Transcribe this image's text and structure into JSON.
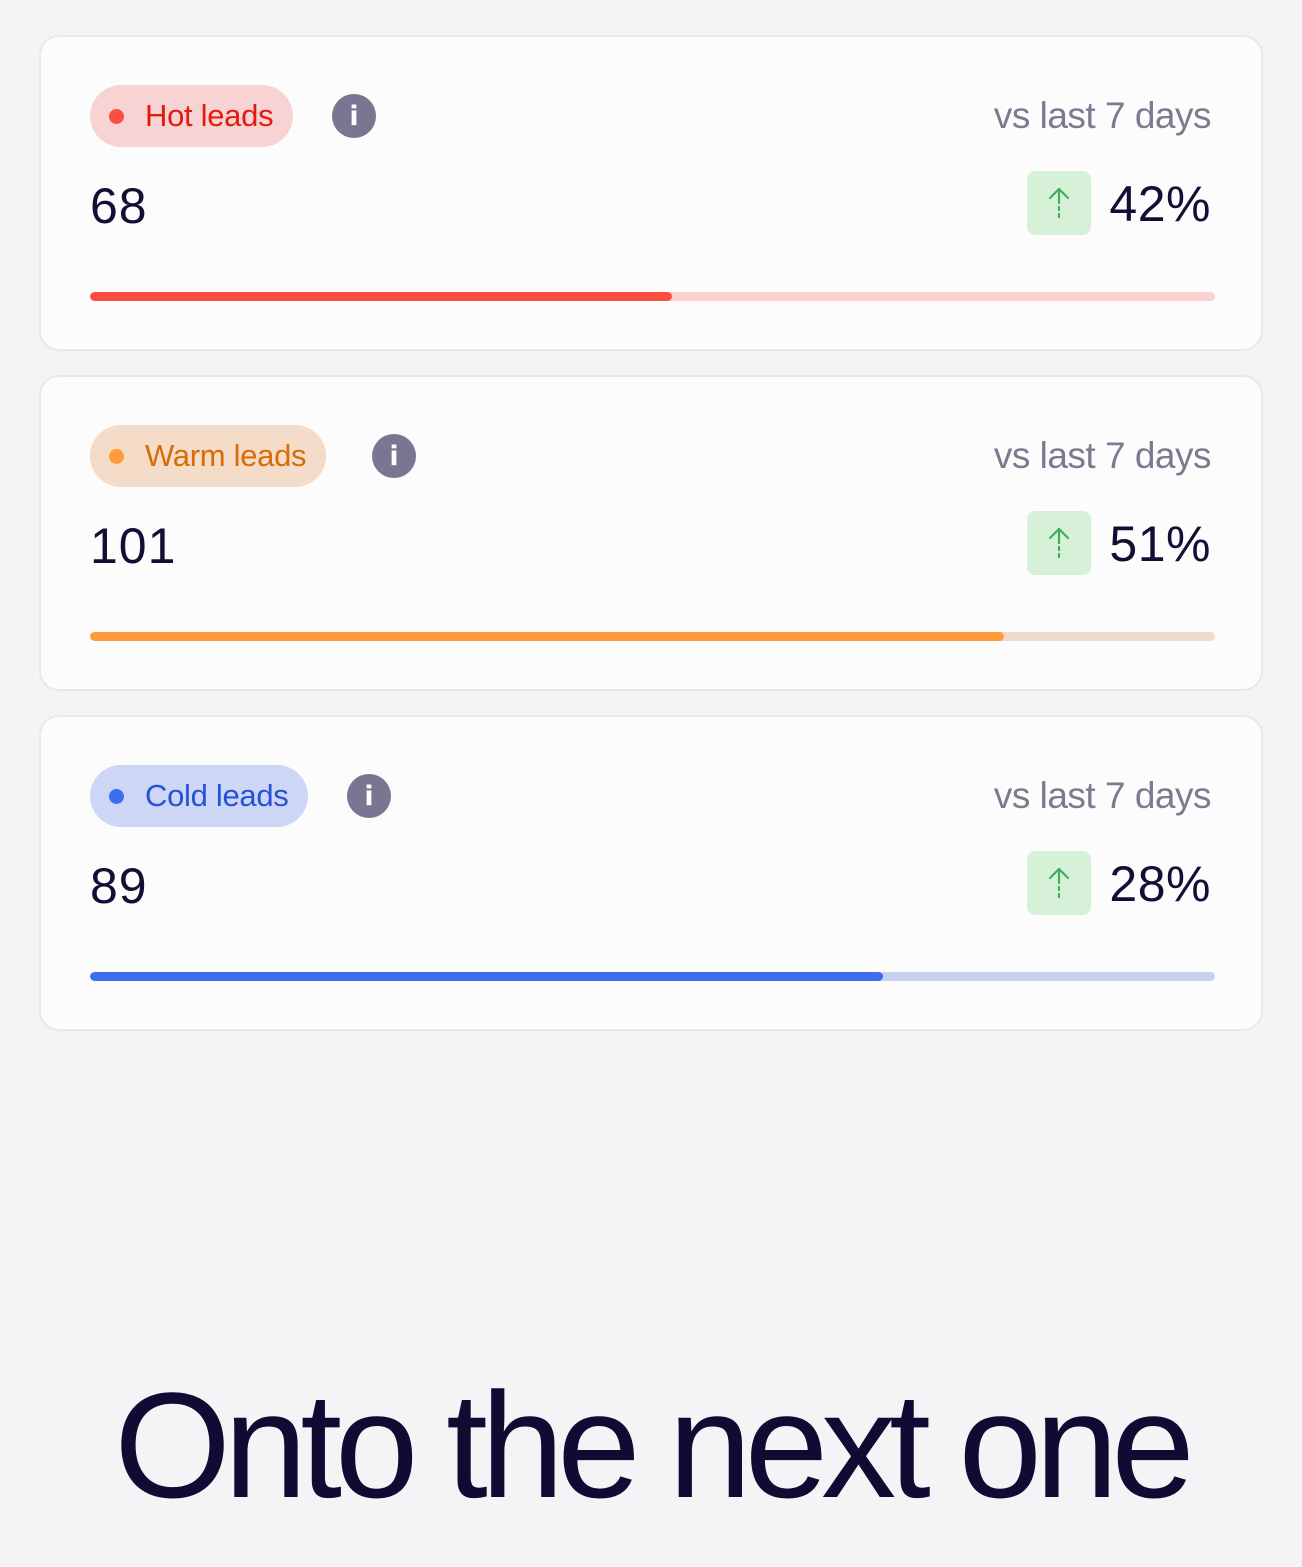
{
  "cards": [
    {
      "label": "Hot leads",
      "count": "68",
      "period": "vs last 7 days",
      "change": "42%",
      "trend": "up-arrow-icon",
      "progress": 0.517,
      "colors": {
        "accent": "#fc4d41",
        "pill_bg": "#f8d3d3",
        "label": "#e31b0f",
        "track": "#fad1d1"
      }
    },
    {
      "label": "Warm leads",
      "count": "101",
      "period": "vs last 7 days",
      "change": "51%",
      "trend": "up-arrow-icon",
      "progress": 0.812,
      "colors": {
        "accent": "#ff9b3b",
        "pill_bg": "#f4dcc8",
        "label": "#d76d07",
        "track": "#efdbc9"
      }
    },
    {
      "label": "Cold leads",
      "count": "89",
      "period": "vs last 7 days",
      "change": "28%",
      "trend": "up-arrow-icon",
      "progress": 0.705,
      "colors": {
        "accent": "#3d6ef1",
        "pill_bg": "#cdd6f4",
        "label": "#2453d9",
        "track": "#c7d0ef"
      }
    }
  ],
  "headline": "Onto the next one",
  "colors": {
    "page_bg": "#f4f3f5",
    "card_bg": "#fdfcfd",
    "text_dark": "#120e35",
    "info_icon": "#787690",
    "trend_bg": "#d7f1d9",
    "trend_arrow": "#3fad5b"
  }
}
